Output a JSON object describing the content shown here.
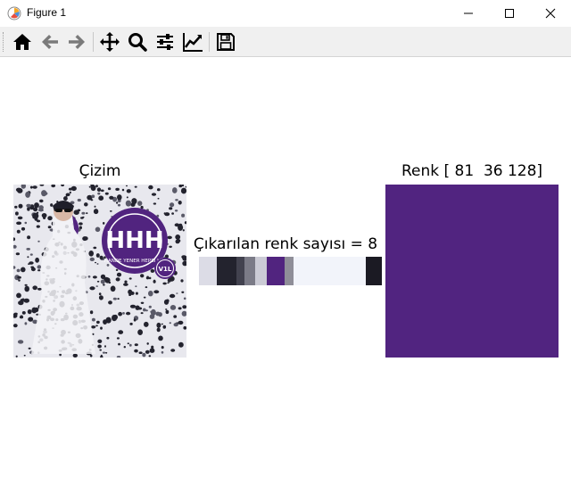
{
  "window": {
    "title": "Figure 1",
    "icon": "matplotlib-icon"
  },
  "window_controls": [
    "minimize-icon",
    "maximize-icon",
    "close-icon"
  ],
  "toolbar": {
    "buttons": [
      {
        "name": "home",
        "icon": "home-icon",
        "label": "Home"
      },
      {
        "name": "back",
        "icon": "arrow-left-icon",
        "label": "Back"
      },
      {
        "name": "forward",
        "icon": "arrow-right-icon",
        "label": "Forward"
      },
      {
        "name": "pan",
        "icon": "move-icon",
        "label": "Pan"
      },
      {
        "name": "zoom",
        "icon": "search-icon",
        "label": "Zoom"
      },
      {
        "name": "configure",
        "icon": "sliders-icon",
        "label": "Configure subplots"
      },
      {
        "name": "edit",
        "icon": "chart-line-icon",
        "label": "Edit axis"
      },
      {
        "name": "save",
        "icon": "save-icon",
        "label": "Save"
      }
    ]
  },
  "figure": {
    "left_title": "Çizim",
    "middle_title": "Çıkarılan renk sayısı = 8",
    "right_title": "Renk [ 81  36 128]",
    "palette_colors": [
      "#dcdce6",
      "#23232e",
      "#42424f",
      "#7b7b87",
      "#cbcbd5",
      "#51247f",
      "#8f8e98",
      "#f2f4fa",
      "#1b1a23"
    ],
    "palette_widths": [
      0.105,
      0.11,
      0.05,
      0.06,
      0.065,
      0.105,
      0.05,
      0.42,
      0.09
    ],
    "selected_color": "#512480",
    "album_logo": {
      "initials": "HHH",
      "caption": "HANDE YENER HEPSİ HİT",
      "volume": "V1L"
    }
  }
}
